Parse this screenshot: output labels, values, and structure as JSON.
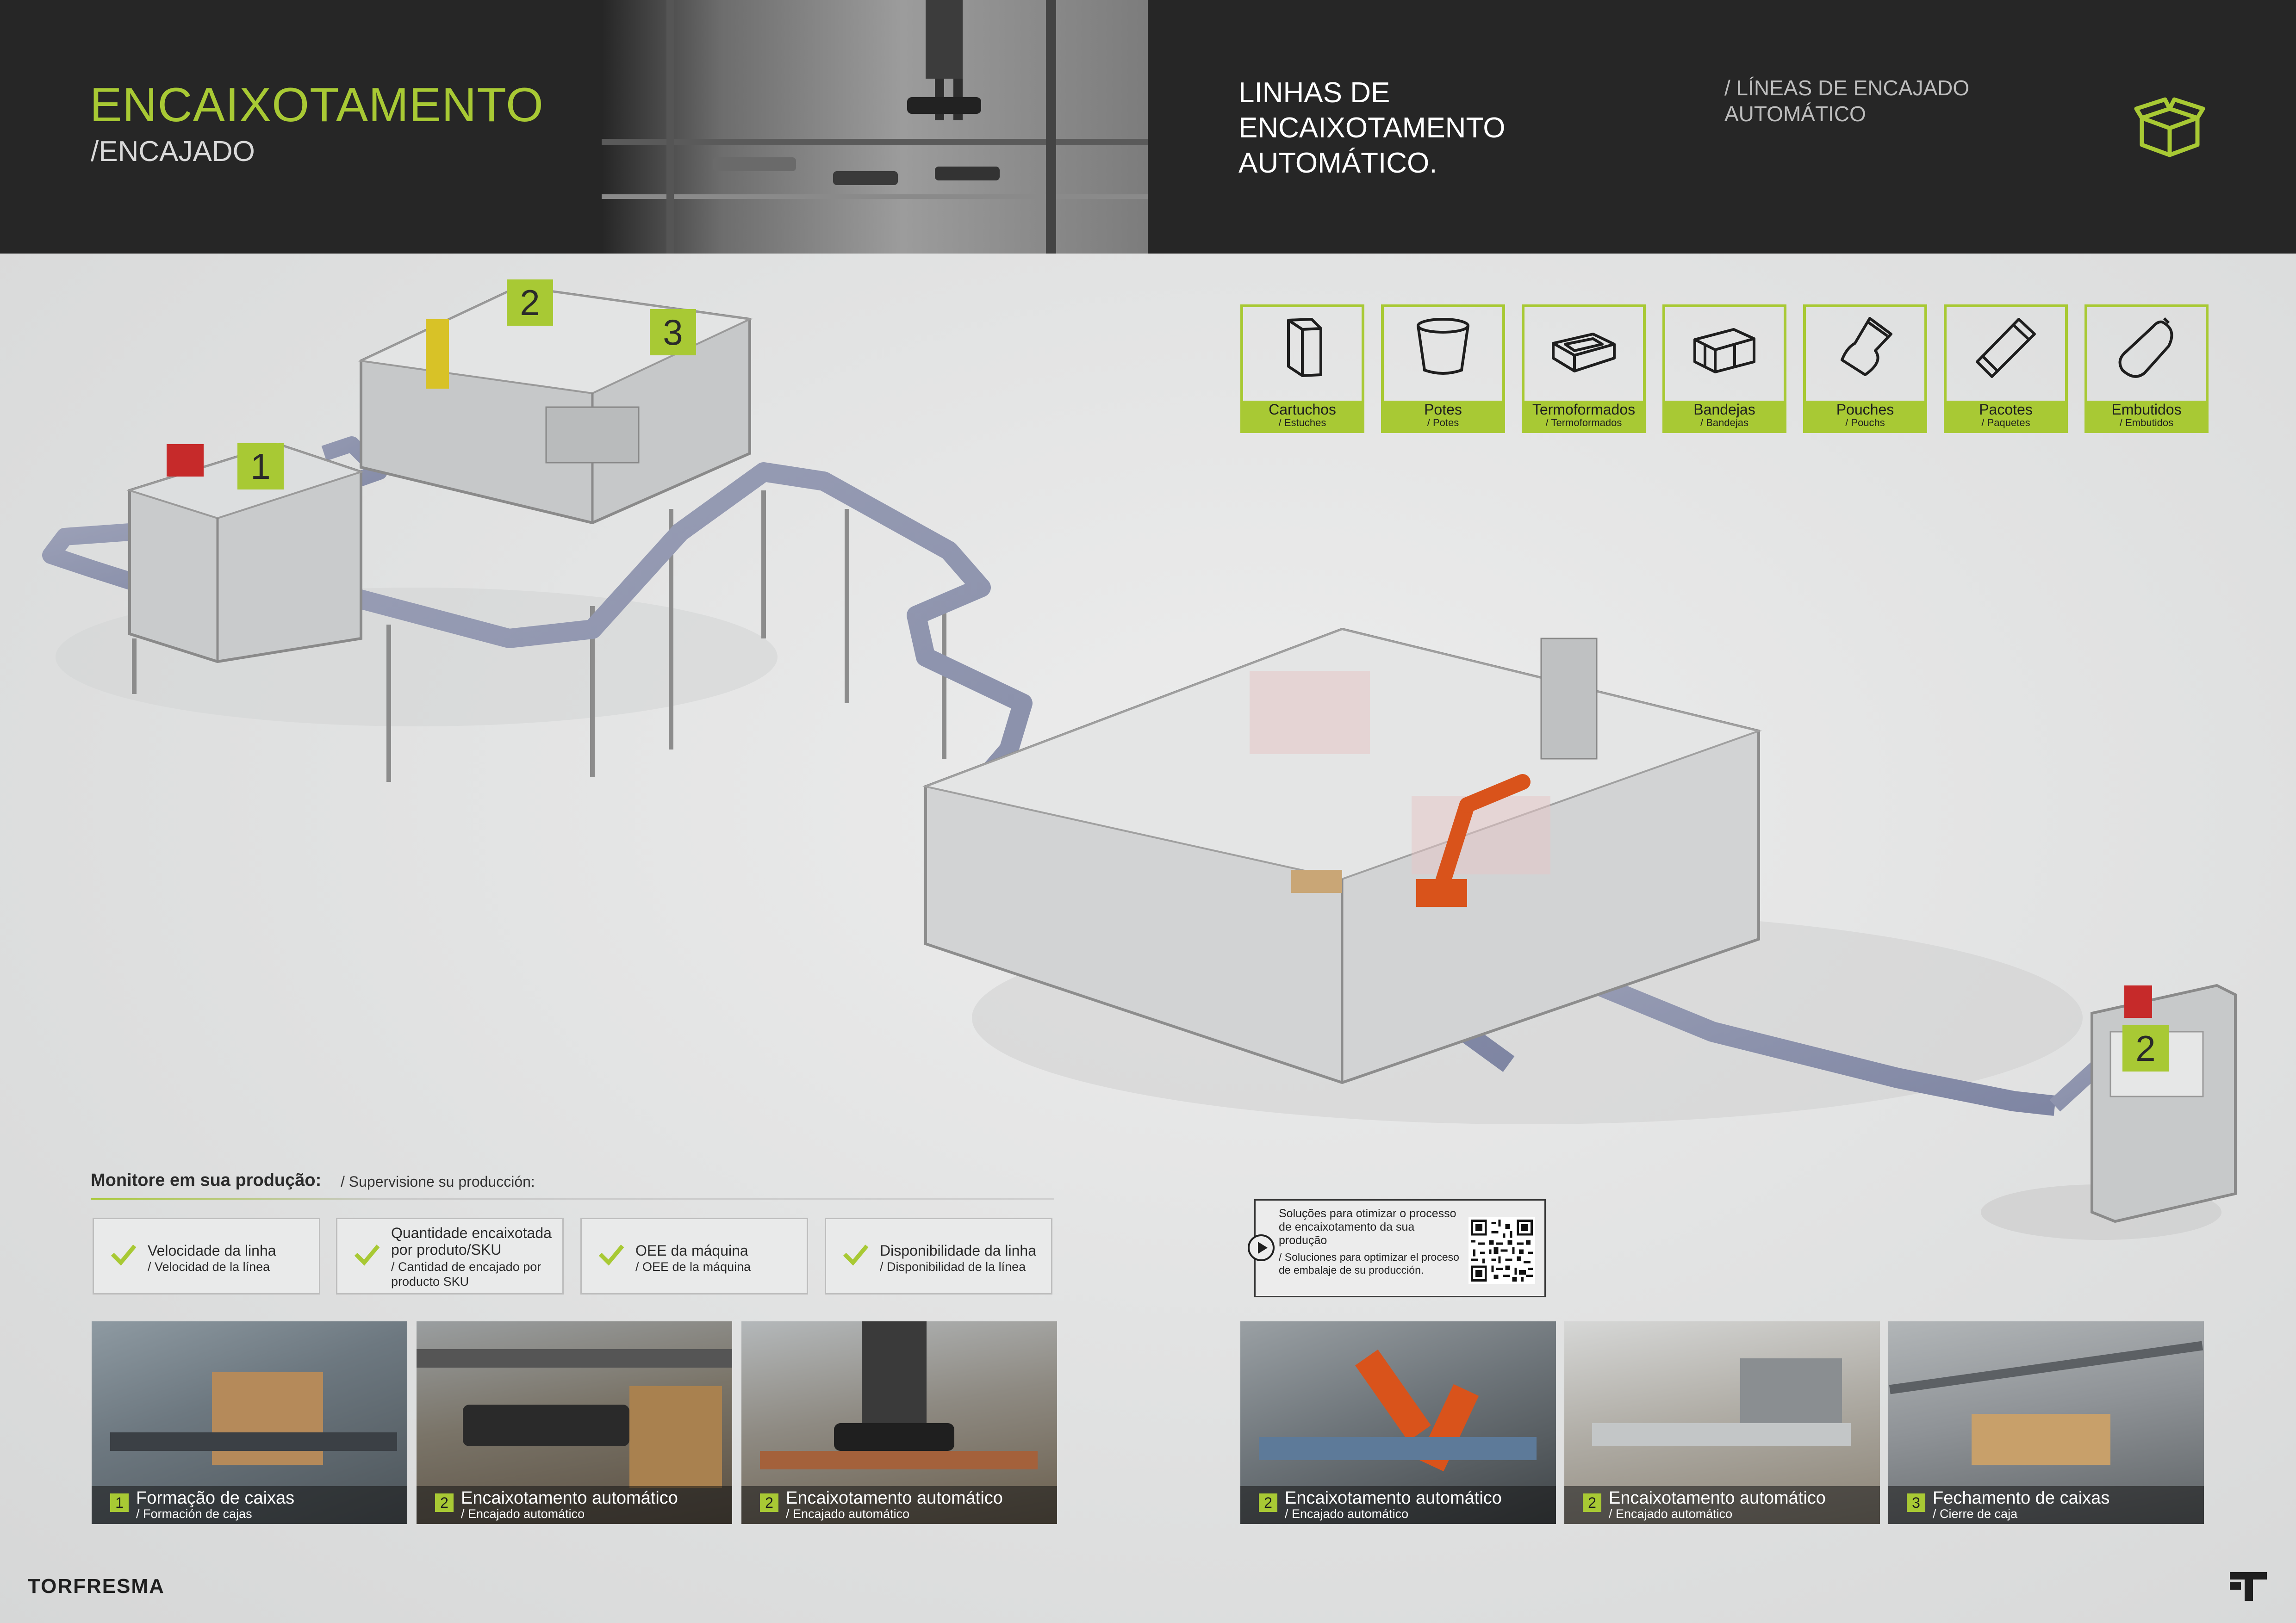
{
  "header": {
    "title": "ENCAIXOTAMENTO",
    "subtitle": "/ENCAJADO",
    "right_title_line1": "LINHAS DE ENCAIXOTAMENTO",
    "right_title_line2": "AUTOMÁTICO.",
    "right_sub_line1": "/ LÍNEAS DE ENCAJADO",
    "right_sub_line2": "AUTOMÁTICO",
    "icon": "box-icon"
  },
  "diagram": {
    "markers": [
      "1",
      "2",
      "3",
      "2"
    ]
  },
  "products": [
    {
      "label": "Cartuchos",
      "sub": "/ Estuches",
      "icon": "carton-icon"
    },
    {
      "label": "Potes",
      "sub": "/ Potes",
      "icon": "pot-icon"
    },
    {
      "label": "Termoformados",
      "sub": "/ Termoformados",
      "icon": "thermoformed-icon"
    },
    {
      "label": "Bandejas",
      "sub": "/ Bandejas",
      "icon": "tray-icon"
    },
    {
      "label": "Pouches",
      "sub": "/ Pouchs",
      "icon": "pouch-icon"
    },
    {
      "label": "Pacotes",
      "sub": "/ Paquetes",
      "icon": "packet-icon"
    },
    {
      "label": "Embutidos",
      "sub": "/ Embutidos",
      "icon": "sausage-icon"
    }
  ],
  "monitor": {
    "title": "Monitore em sua produção:",
    "subtitle": "/ Supervisione su producción:",
    "items": [
      {
        "l1": "Velocidade da linha",
        "l2": "/ Velocidad de la línea"
      },
      {
        "l1a": "Quantidade encaixotada",
        "l1b": "por produto/SKU",
        "l2a": "/ Cantidad de encajado por",
        "l2b": "producto SKU"
      },
      {
        "l1": "OEE da máquina",
        "l2": "/ OEE de la máquina"
      },
      {
        "l1": "Disponibilidade da linha",
        "l2": "/ Disponibilidad de la línea"
      }
    ]
  },
  "qr": {
    "text1": "Soluções para otimizar o processo de encaixotamento da sua produção",
    "text2": "/ Soluciones para optimizar el proceso de embalaje de su producción."
  },
  "photos_left": [
    {
      "num": "1",
      "title": "Formação de caixas",
      "sub": "/ Formación de cajas"
    },
    {
      "num": "2",
      "title": "Encaixotamento automático",
      "sub": "/ Encajado automático"
    },
    {
      "num": "2",
      "title": "Encaixotamento automático",
      "sub": "/ Encajado automático"
    }
  ],
  "photos_right": [
    {
      "num": "2",
      "title": "Encaixotamento automático",
      "sub": "/ Encajado automático"
    },
    {
      "num": "2",
      "title": "Encaixotamento automático",
      "sub": "/ Encajado automático"
    },
    {
      "num": "3",
      "title": "Fechamento de caixas",
      "sub": "/ Cierre de caja"
    }
  ],
  "footer": {
    "brand": "TORFRESMA"
  },
  "colors": {
    "accent": "#a8c934",
    "header_bg": "#262626",
    "scene_bg": "#e2e3e3"
  }
}
